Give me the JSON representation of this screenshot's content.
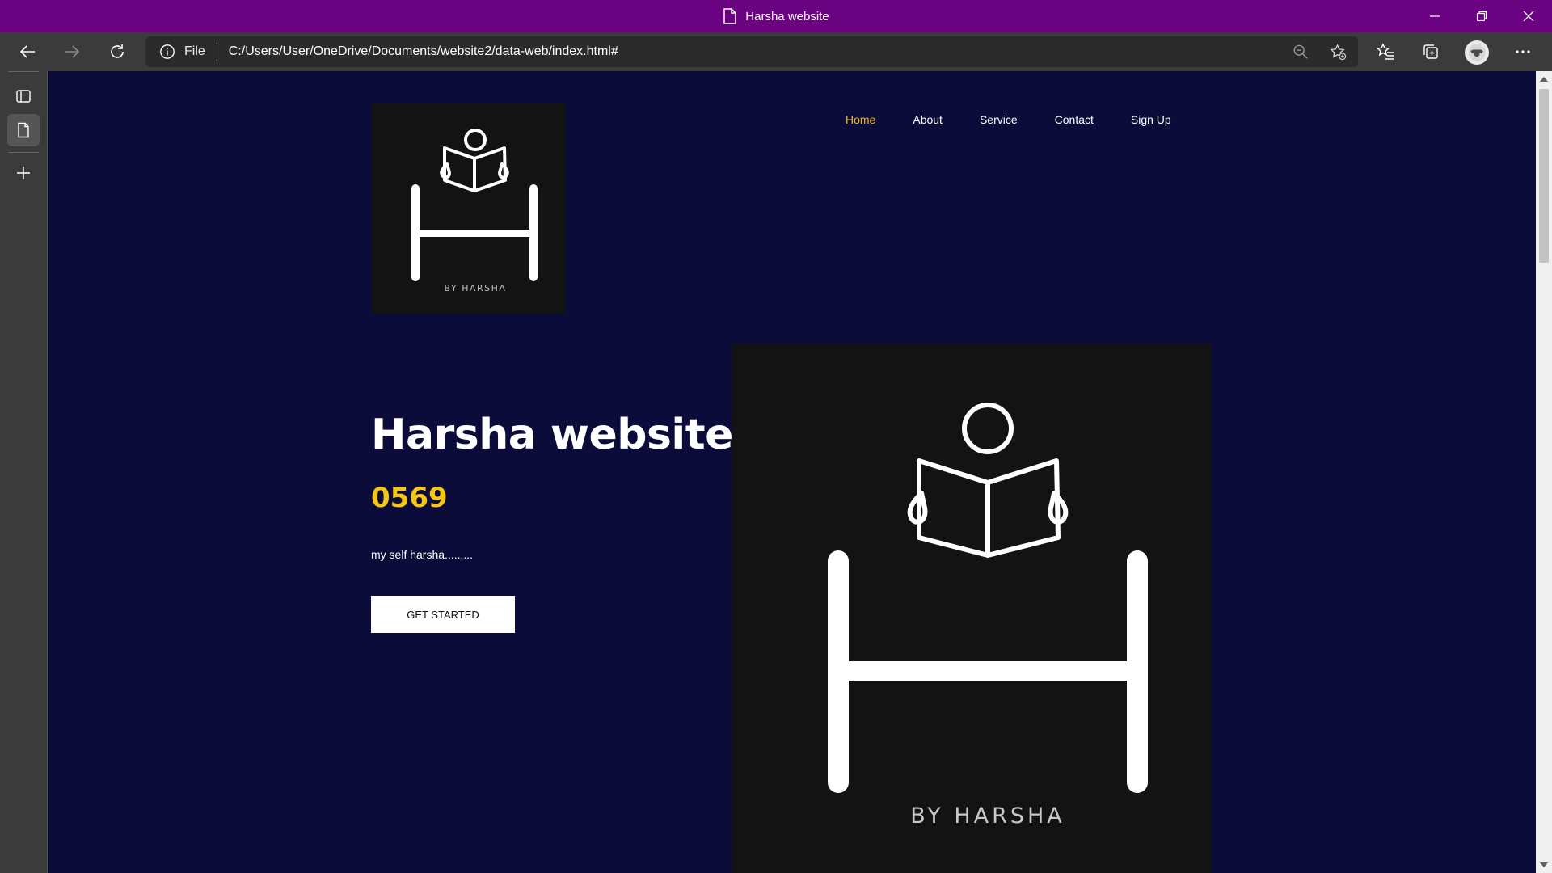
{
  "window": {
    "title": "Harsha website"
  },
  "browser": {
    "address": {
      "scheme": "File",
      "url": "C:/Users/User/OneDrive/Documents/website2/data-web/index.html#"
    }
  },
  "page": {
    "logo": {
      "brand_text": "BY HARSHA"
    },
    "nav": {
      "items": [
        {
          "label": "Home",
          "active": true
        },
        {
          "label": "About",
          "active": false
        },
        {
          "label": "Service",
          "active": false
        },
        {
          "label": "Contact",
          "active": false
        },
        {
          "label": "Sign Up",
          "active": false
        }
      ]
    },
    "hero": {
      "title": "Harsha website",
      "number": "0569",
      "description": "my self harsha.........",
      "cta_label": "GET STARTED"
    }
  },
  "colors": {
    "titlebar": "#6b0281",
    "page_background": "#0c0c3a",
    "accent_yellow": "#f5c518",
    "nav_active": "#f5b915"
  },
  "icons": [
    "page-icon",
    "back-icon",
    "forward-icon",
    "refresh-icon",
    "info-icon",
    "zoom-out-icon",
    "add-favorite-icon",
    "favorites-icon",
    "collections-icon",
    "profile-icon",
    "more-icon",
    "tab-actions-icon",
    "tab-page-icon",
    "new-tab-icon",
    "minimize-icon",
    "restore-icon",
    "close-icon"
  ]
}
